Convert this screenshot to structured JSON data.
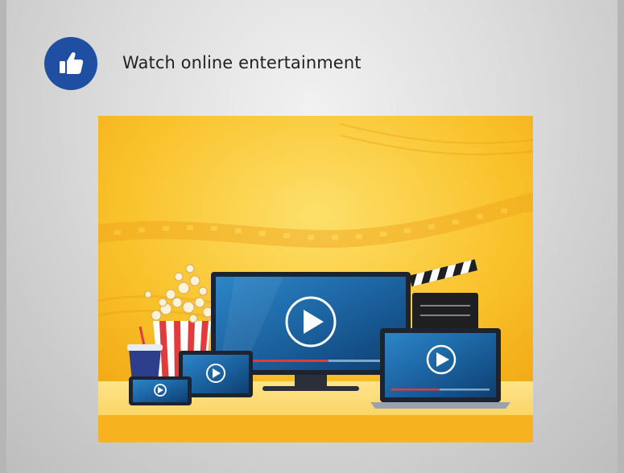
{
  "slide": {
    "heading": "Watch online entertainment",
    "badge_icon": "thumbs-up-icon",
    "badge_color": "#1f4fa3"
  },
  "illustration": {
    "subject": "media devices with popcorn, drink and clapperboard",
    "background_color": "#f7b91b",
    "screen_color": "#1a5f9c",
    "progress_color": "#e23b3b"
  }
}
